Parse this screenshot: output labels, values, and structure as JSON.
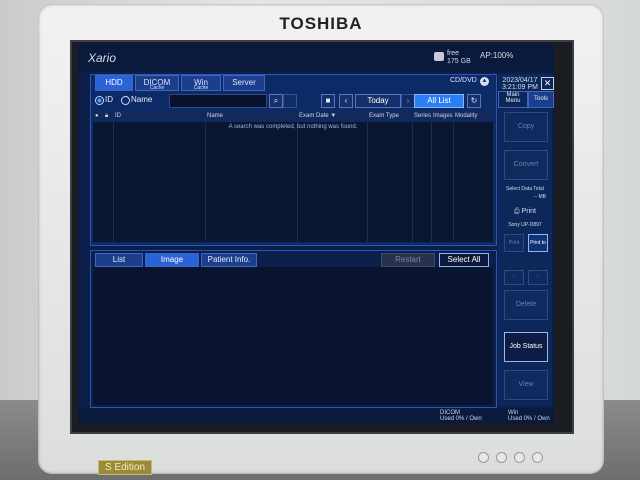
{
  "device": {
    "brand": "TOSHIBA",
    "edition": "S Edition"
  },
  "topbar": {
    "app_name": "Xario",
    "free_label": "free",
    "free_value": "175 GB",
    "ap_status": "AP:100%"
  },
  "hdd_panel": {
    "tabs": [
      {
        "label": "HDD",
        "sub": ""
      },
      {
        "label": "DICOM",
        "sub": "Cache"
      },
      {
        "label": "Win",
        "sub": "Cache"
      },
      {
        "label": "Server",
        "sub": ""
      }
    ],
    "cd_label": "CD/DVD",
    "radio_id": "ID",
    "radio_name": "Name",
    "search_value": "",
    "today_label": "Today",
    "all_list_label": "All List",
    "columns": [
      "ID",
      "Name",
      "Exam Date ▼",
      "Exam Type",
      "Series",
      "Images",
      "Modality"
    ],
    "message": "A search was completed, but nothing was found."
  },
  "image_panel": {
    "tabs": [
      "List",
      "Image",
      "Patient Info."
    ],
    "restart_label": "Restart",
    "select_all_label": "Select All"
  },
  "sidebar": {
    "date": "2023/04/17",
    "time": "3:21:09 PM",
    "tab_main": "Main Menu",
    "tab_tools": "Tools",
    "copy_label": "Copy",
    "convert_label": "Convert",
    "select_data_total": "Select Data Total",
    "data_total_value": "-- MB",
    "print_label": "Print",
    "printer_name": "Sony UP-D897",
    "print_btn": "Print",
    "print_to_btn": "Print to",
    "delete_label": "Delete",
    "job_status_label": "Job Status",
    "view_label": "View"
  },
  "status": {
    "dicom_label": "DICOM",
    "dicom_stats": "Used 0% / Own",
    "win_label": "Win",
    "win_stats": "Used 0% / Own"
  },
  "colors": {
    "screen_bg": "#0b1f4a",
    "accent_blue": "#2b7ef4",
    "panel_border": "#2c57b6"
  }
}
